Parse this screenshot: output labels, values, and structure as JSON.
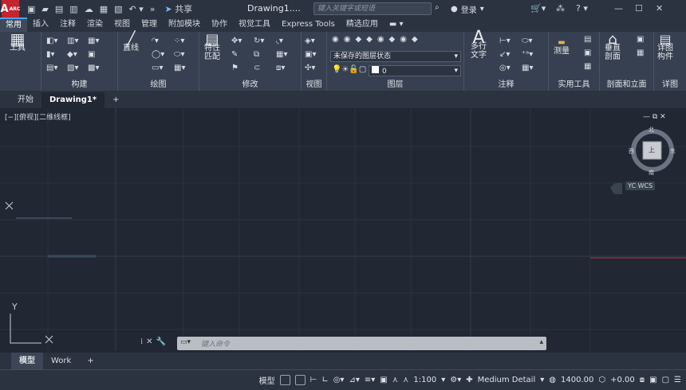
{
  "app": {
    "logo_text": "A",
    "logo_sub": "ARC",
    "title": "Drawing1....",
    "share_label": "共享",
    "search_placeholder": "键入关键字或短语",
    "login_label": "登录",
    "help": "?"
  },
  "ribbon_tabs": [
    "常用",
    "插入",
    "注释",
    "渲染",
    "视图",
    "管理",
    "附加模块",
    "协作",
    "视觉工具",
    "Express Tools",
    "精选应用"
  ],
  "ribbon": {
    "tools_label": "工具",
    "line_label": "直线",
    "match_label": "特性\n匹配",
    "mtext_label": "多行\n文字",
    "measure_label": "测量",
    "section_label": "垂直\n剖面",
    "detail_label": "详图\n构件",
    "layer_state": "未保存的图层状态",
    "layer_value": "0",
    "panels": [
      "构建",
      "绘图",
      "修改",
      "视图",
      "图层",
      "注释",
      "实用工具",
      "剖面和立面",
      "详图"
    ]
  },
  "doc_tabs": {
    "start": "开始",
    "drawing": "Drawing1*",
    "add": "+"
  },
  "canvas": {
    "view_label": "[−][俯视][二维线框]",
    "compass": {
      "n": "北",
      "s": "南",
      "e": "东",
      "w": "西",
      "top": "上"
    },
    "wcs": "YC WCS",
    "y_label": "Y",
    "x_label": "X"
  },
  "command": {
    "placeholder": "键入命令"
  },
  "layout_tabs": {
    "model": "模型",
    "work": "Work",
    "add": "+"
  },
  "status": {
    "model": "模型",
    "scale": "1:100",
    "detail": "Medium Detail",
    "elevation": "1400.00",
    "offset": "+0.00"
  },
  "colors": {
    "accent": "#4aa3ff",
    "logo": "#c4242d",
    "x_axis": "#c0303a"
  }
}
